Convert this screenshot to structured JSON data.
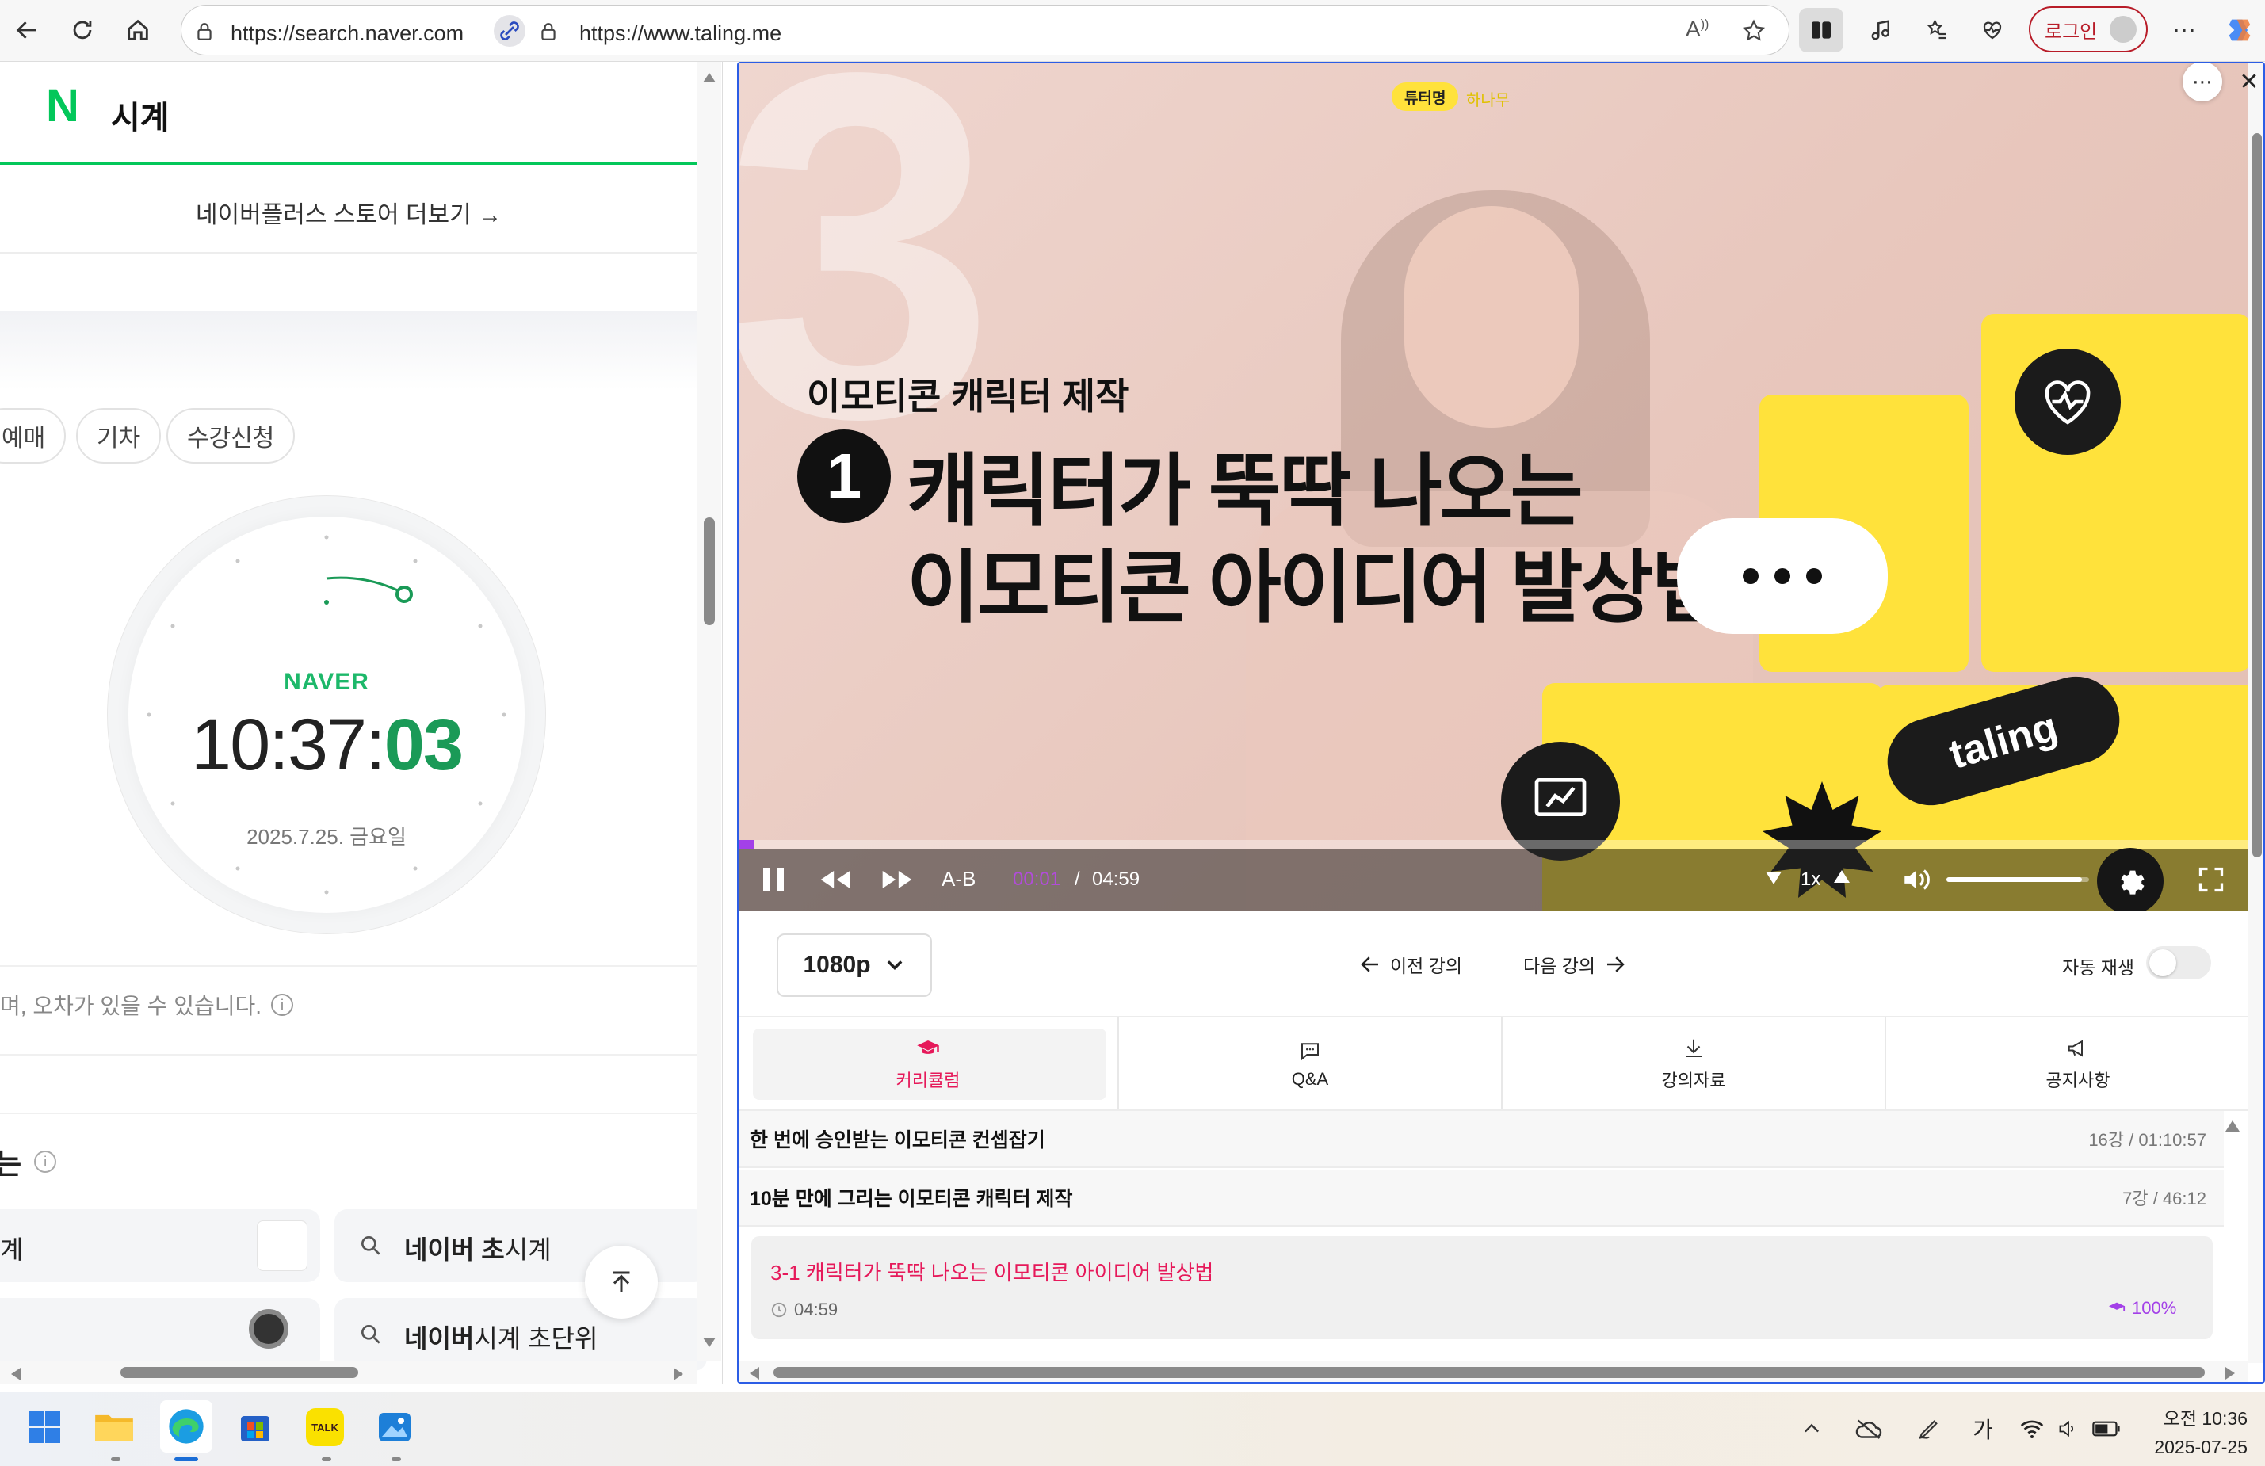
{
  "browser": {
    "left_url": "https://search.naver.com",
    "right_url": "https://www.taling.me",
    "login_label": "로그인"
  },
  "naver": {
    "logo": "N",
    "title": "시계",
    "store_more": "네이버플러스 스토어 더보기 →",
    "chips": [
      "예매",
      "기차",
      "수강신청"
    ],
    "brand": "NAVER",
    "time_hm": "10:37:",
    "time_sec": "03",
    "date": "2025.7.25. 금요일",
    "notice": "며, 오차가 있을 수 있습니다.",
    "related_fragment": "는",
    "suggest": [
      {
        "text_left": "계"
      },
      {
        "bold": "네이버 초",
        "rest": "시계"
      },
      {
        "bold": "네이버",
        "rest": "시계 초단위"
      }
    ]
  },
  "video": {
    "tutor_badge": "튜터명",
    "tutor_name": "하나무",
    "subtitle": "이모티콘 캐릭터 제작",
    "number": "1",
    "title_line1": "캐릭터가 뚝딱 나오는",
    "title_line2": "이모티콘 아이디어 발상법",
    "brand_tag": "taling",
    "ab": "A-B",
    "current_time": "00:01",
    "separator": "/",
    "duration": "04:59",
    "speed": "1x",
    "progress": 0.01,
    "volume": 0.95
  },
  "controls": {
    "quality": "1080p",
    "prev": "이전 강의",
    "next": "다음 강의",
    "autoplay_label": "자동 재생"
  },
  "tabs": [
    {
      "label": "커리큘럼",
      "icon": "graduation-cap-icon",
      "active": true
    },
    {
      "label": "Q&A",
      "icon": "chat-bubble-icon",
      "active": false
    },
    {
      "label": "강의자료",
      "icon": "download-icon",
      "active": false
    },
    {
      "label": "공지사항",
      "icon": "megaphone-icon",
      "active": false
    }
  ],
  "curriculum": [
    {
      "title": "한 번에 승인받는 이모티콘 컨셉잡기",
      "meta": "16강 / 01:10:57"
    },
    {
      "title": "10분 만에 그리는 이모티콘 캐릭터 제작",
      "meta": "7강 / 46:12"
    }
  ],
  "current_lesson": {
    "title": "3-1 캐릭터가 뚝딱 나오는 이모티콘 아이디어 발상법",
    "duration": "04:59",
    "progress": "100%"
  },
  "taskbar": {
    "ime": "가",
    "ampm_time": "오전 10:36",
    "date": "2025-07-25"
  },
  "colors": {
    "naver_green": "#03c75a",
    "taling_pink": "#e6195a",
    "taling_yellow": "#ffe23b",
    "progress_purple": "#a340e8"
  }
}
